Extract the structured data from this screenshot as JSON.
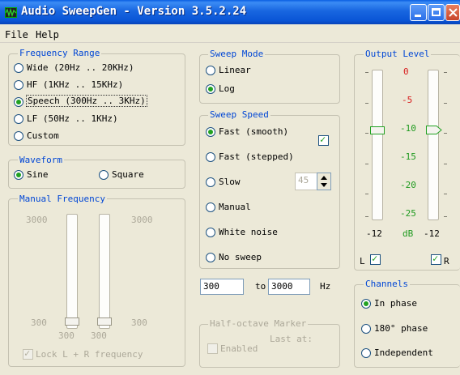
{
  "window": {
    "title": "Audio SweepGen - Version 3.5.2.24"
  },
  "menu": {
    "file": "File",
    "help": "Help"
  },
  "frequency_range": {
    "title": "Frequency Range",
    "options": [
      "Wide  (20Hz .. 20KHz)",
      "HF  (1KHz .. 15KHz)",
      "Speech  (300Hz .. 3KHz)",
      "LF  (50Hz .. 1KHz)",
      "Custom"
    ],
    "selected": "Speech  (300Hz .. 3KHz)"
  },
  "waveform": {
    "title": "Waveform",
    "sine": "Sine",
    "square": "Square",
    "selected": "Sine"
  },
  "manual_frequency": {
    "title": "Manual Frequency",
    "top_left": "3000",
    "top_right": "3000",
    "bottom_left": "300",
    "bottom_right": "300",
    "bottom_left_inner": "300",
    "bottom_right_inner": "300",
    "lock_label": "Lock L + R frequency"
  },
  "sweep_mode": {
    "title": "Sweep Mode",
    "linear": "Linear",
    "log": "Log",
    "selected": "Log"
  },
  "sweep_speed": {
    "title": "Sweep Speed",
    "options": [
      "Fast (smooth)",
      "Fast (stepped)",
      "Slow",
      "Manual",
      "White noise",
      "No sweep"
    ],
    "selected": "Fast (smooth)",
    "slow_value": "45"
  },
  "range_fields": {
    "from": "300",
    "to_label": "to",
    "to": "3000",
    "unit": "Hz"
  },
  "half_octave": {
    "title": "Half-octave Marker",
    "last_at": "Last at:",
    "enabled": "Enabled"
  },
  "output_level": {
    "title": "Output Level",
    "scale": [
      "0",
      "-5",
      "-10",
      "-15",
      "-20",
      "-25"
    ],
    "left_value": "-12",
    "unit": "dB",
    "right_value": "-12",
    "left_label": "L",
    "right_label": "R",
    "level_db": -12
  },
  "channels": {
    "title": "Channels",
    "in_phase": "In phase",
    "phase180": "180°  phase",
    "independent": "Independent",
    "selected": "In phase"
  },
  "colors": {
    "accent_blue": "#0046d5",
    "scale_red": "#d81e1e",
    "scale_green": "#1f9a1f",
    "radio_green": "#21a121"
  }
}
